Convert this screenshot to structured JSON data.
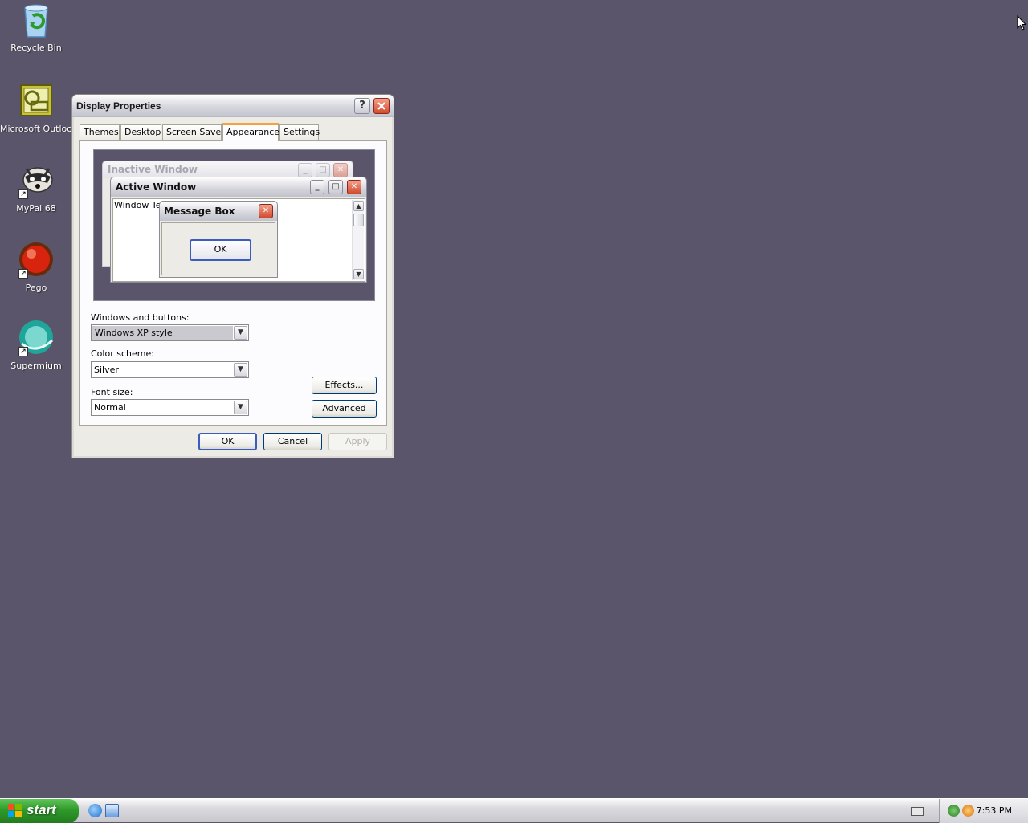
{
  "desktop": {
    "background_color": "#5a556a",
    "icons": [
      {
        "label": "Recycle Bin",
        "icon": "recycle-bin-icon"
      },
      {
        "label": "Microsoft Outlook",
        "icon": "outlook-icon"
      },
      {
        "label": "MyPal 68",
        "icon": "mypal-icon"
      },
      {
        "label": "Pego",
        "icon": "pego-icon"
      },
      {
        "label": "Supermium",
        "icon": "supermium-icon"
      }
    ]
  },
  "dialog": {
    "title": "Display Properties",
    "help_button": "?",
    "tabs": [
      {
        "label": "Themes"
      },
      {
        "label": "Desktop"
      },
      {
        "label": "Screen Saver"
      },
      {
        "label": "Appearance",
        "active": true
      },
      {
        "label": "Settings"
      }
    ],
    "preview": {
      "inactive_title": "Inactive Window",
      "active_title": "Active Window",
      "window_text": "Window Text",
      "message_title": "Message Box",
      "message_ok": "OK"
    },
    "windows_buttons": {
      "label": "Windows and buttons:",
      "value": "Windows XP style"
    },
    "color_scheme": {
      "label": "Color scheme:",
      "value": "Silver"
    },
    "font_size": {
      "label": "Font size:",
      "value": "Normal"
    },
    "effects_button": "Effects...",
    "advanced_button": "Advanced",
    "ok_button": "OK",
    "cancel_button": "Cancel",
    "apply_button": "Apply"
  },
  "taskbar": {
    "start_label": "start",
    "clock": "7:53 PM"
  }
}
